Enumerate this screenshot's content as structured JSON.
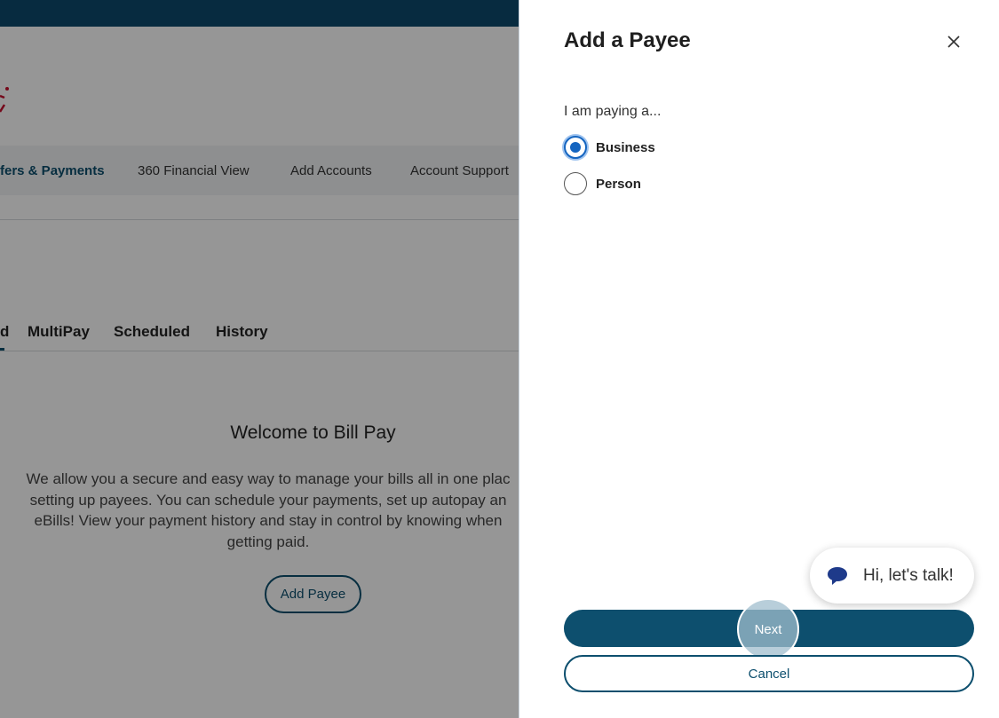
{
  "background": {
    "nav": {
      "items": [
        {
          "label": "fers & Payments",
          "active": true
        },
        {
          "label": "360 Financial View"
        },
        {
          "label": "Add Accounts"
        },
        {
          "label": "Account Support"
        }
      ]
    },
    "tabs": [
      {
        "label": "d"
      },
      {
        "label": "MultiPay"
      },
      {
        "label": "Scheduled"
      },
      {
        "label": "History"
      }
    ],
    "welcome": {
      "title": "Welcome to Bill Pay",
      "text": "We allow you a secure and easy way to manage your bills all in one plac\nsetting up payees. You can schedule your payments, set up autopay an\neBills! View your payment history and stay in control by knowing when\ngetting paid.",
      "add_payee_label": "Add Payee"
    }
  },
  "drawer": {
    "title": "Add a Payee",
    "close_icon": "close-icon",
    "question": "I am paying a...",
    "options": [
      {
        "label": "Business",
        "selected": true
      },
      {
        "label": "Person",
        "selected": false
      }
    ],
    "chat": {
      "label": "Hi, let's talk!",
      "icon": "chat-bubble-icon"
    },
    "next_label": "Next",
    "cancel_label": "Cancel"
  },
  "colors": {
    "brand": "#0d4f6e",
    "topbar": "#0c4a6e",
    "radio_selected": "#1565c0",
    "logo_red": "#c8102e"
  }
}
